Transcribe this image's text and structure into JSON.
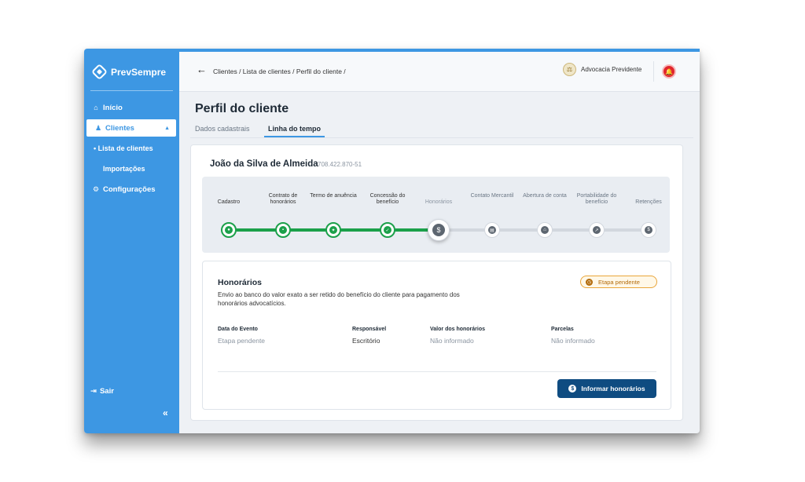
{
  "app": {
    "name": "PrevSempre"
  },
  "sidebar": {
    "items": [
      {
        "label": "Início"
      },
      {
        "label": "Clientes"
      },
      {
        "label": "Configurações"
      }
    ],
    "subitems": [
      {
        "label": "Lista de clientes"
      },
      {
        "label": "Importações"
      }
    ],
    "logout": "Sair",
    "collapse": "«"
  },
  "header": {
    "back": "←",
    "breadcrumb": "Clientes / Lista de clientes / Perfil do cliente /",
    "org": "Advocacia Previdente"
  },
  "page": {
    "title": "Perfil do cliente",
    "tabs": [
      {
        "label": "Dados cadastrais"
      },
      {
        "label": "Linha do tempo"
      }
    ]
  },
  "client": {
    "name": "João da Silva de Almeida",
    "cpf": "708.422.870-51"
  },
  "timeline": {
    "steps": [
      {
        "label": "Cadastro",
        "status": "done",
        "icon": "person-icon",
        "glyph": "●"
      },
      {
        "label": "Contrato de honorários",
        "status": "done",
        "icon": "document-icon",
        "glyph": "▪"
      },
      {
        "label": "Termo de anuência",
        "status": "done",
        "icon": "handshake-icon",
        "glyph": "✦"
      },
      {
        "label": "Concessão do benefício",
        "status": "done",
        "icon": "check-icon",
        "glyph": "✓"
      },
      {
        "label": "Honorários",
        "status": "current",
        "icon": "dollar-icon",
        "glyph": "$"
      },
      {
        "label": "Contato Mercantil",
        "status": "todo",
        "icon": "chat-icon",
        "glyph": "▤"
      },
      {
        "label": "Abertura de conta",
        "status": "todo",
        "icon": "bank-icon",
        "glyph": "⌂"
      },
      {
        "label": "Portabilidade do benefício",
        "status": "todo",
        "icon": "transfer-icon",
        "glyph": "↗"
      },
      {
        "label": "Retenções",
        "status": "todo",
        "icon": "coin-icon",
        "glyph": "$"
      }
    ]
  },
  "detail": {
    "title": "Honorários",
    "description": "Envio ao banco do valor exato a ser retido do benefício do cliente para pagamento dos honorários advocatícios.",
    "badge": "Etapa pendente",
    "fields": [
      {
        "label": "Data do Evento",
        "value": "Etapa pendente"
      },
      {
        "label": "Responsável",
        "value": "Escritório"
      },
      {
        "label": "Valor dos honorários",
        "value": "Não informado"
      },
      {
        "label": "Parcelas",
        "value": "Não informado"
      }
    ],
    "action": "Informar honorários"
  },
  "colors": {
    "brand": "#3d97e3",
    "success": "#1ba04a",
    "primary_button": "#0f4c81",
    "pending": "#e9a53a",
    "alert": "#e1262d"
  }
}
